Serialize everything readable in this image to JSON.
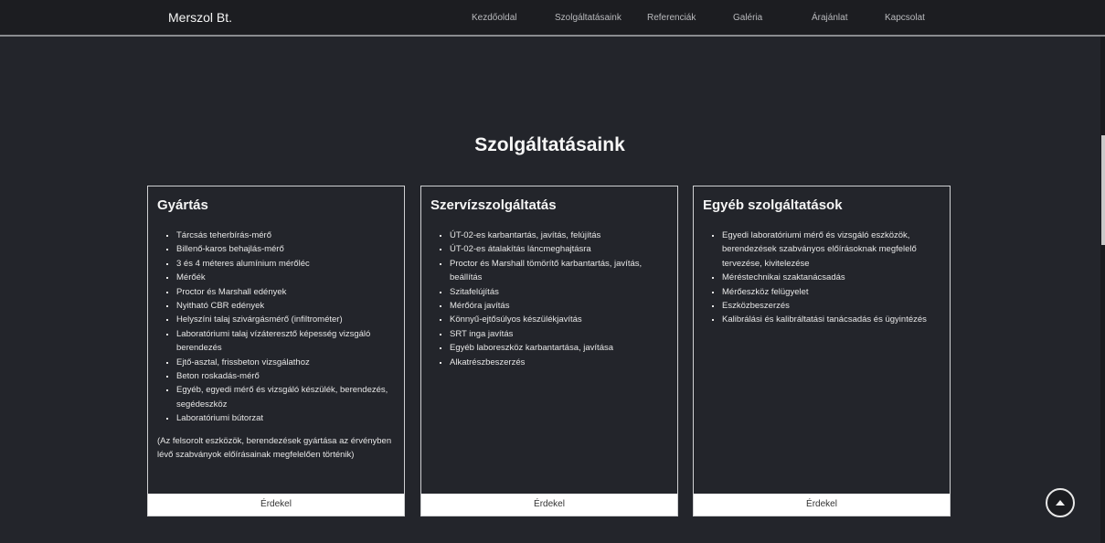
{
  "navbar": {
    "brand": "Merszol Bt.",
    "links": [
      "Kezdőoldal",
      "Szolgáltatásaink",
      "Referenciák",
      "Galéria",
      "Árajánlat",
      "Kapcsolat"
    ]
  },
  "services": {
    "title": "Szolgáltatásaink",
    "cards": [
      {
        "title": "Gyártás",
        "items": [
          "Tárcsás teherbírás-mérő",
          "Billenő-karos behajlás-mérő",
          "3 és 4 méteres alumínium mérőléc",
          "Mérőék",
          "Proctor és Marshall edények",
          "Nyitható CBR edények",
          "Helyszíni talaj szivárgásmérő (infiltrométer)",
          "Laboratóriumi talaj vízáteresztő képesség vizsgáló berendezés",
          "Ejtő-asztal, frissbeton vizsgálathoz",
          "Beton roskadás-mérő",
          "Egyéb, egyedi mérő és vizsgáló készülék, berendezés, segédeszköz",
          "Laboratóriumi bútorzat"
        ],
        "note": "(Az felsorolt eszközök, berendezések gyártása az érvényben lévő szabványok előírásainak megfelelően történik)",
        "button": "Érdekel"
      },
      {
        "title": "Szervízszolgáltatás",
        "items": [
          "ÚT-02-es karbantartás, javítás, felújítás",
          "ÚT-02-es átalakítás láncmeghajtásra",
          "Proctor és Marshall tömörítő karbantartás, javítás, beállítás",
          "Szitafelújítás",
          "Mérőóra javítás",
          "Könnyű-ejtősúlyos készülékjavítás",
          "SRT inga javítás",
          "Egyéb laboreszköz karbantartása, javítása",
          "Alkatrészbeszerzés"
        ],
        "button": "Érdekel"
      },
      {
        "title": "Egyéb szolgáltatások",
        "items": [
          "Egyedi laboratóriumi mérő és vizsgáló eszközök, berendezések szabványos előírásoknak megfelelő tervezése, kivitelezése",
          "Méréstechnikai szaktanácsadás",
          "Mérőeszköz felügyelet",
          "Eszközbeszerzés",
          "Kalibrálási és kalibráltatási tanácsadás és ügyintézés"
        ],
        "button": "Érdekel"
      }
    ]
  },
  "scroll_top_icon": "arrow-up-icon"
}
